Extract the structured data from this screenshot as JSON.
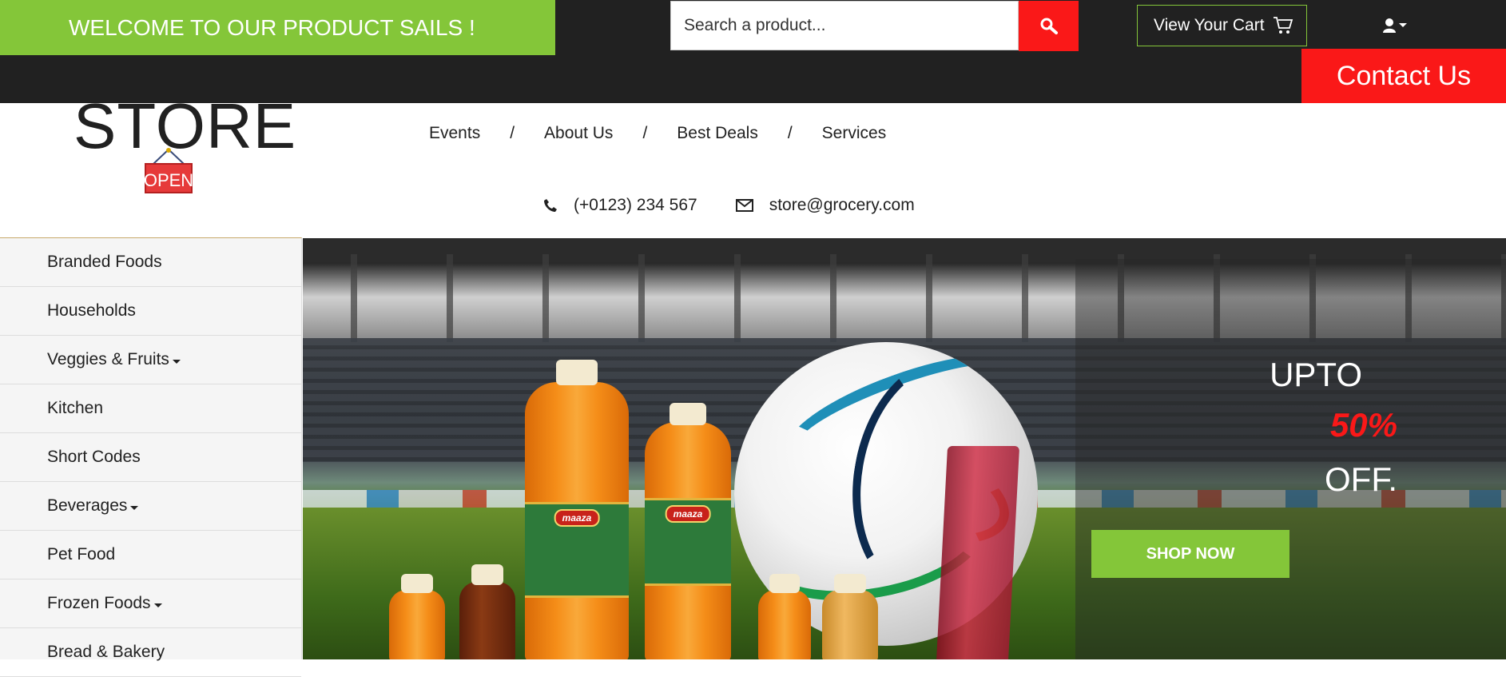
{
  "topbar": {
    "welcome": "WELCOME TO OUR PRODUCT SAILS !",
    "search_placeholder": "Search a product...",
    "cart_label": "View Your Cart",
    "contact_label": "Contact Us"
  },
  "header": {
    "logo_text": "STORE",
    "nav": [
      {
        "label": "Events"
      },
      {
        "label": "About Us"
      },
      {
        "label": "Best Deals"
      },
      {
        "label": "Services"
      }
    ],
    "nav_separator": "/",
    "phone": "(+0123) 234 567",
    "email": "store@grocery.com"
  },
  "sidebar": {
    "items": [
      {
        "label": "Branded Foods"
      },
      {
        "label": "Households"
      },
      {
        "label": "Veggies & Fruits"
      },
      {
        "label": "Kitchen"
      },
      {
        "label": "Short Codes"
      },
      {
        "label": "Beverages"
      },
      {
        "label": "Pet Food"
      },
      {
        "label": "Frozen Foods"
      },
      {
        "label": "Bread & Bakery"
      }
    ]
  },
  "hero": {
    "promo_line1": "UPTO",
    "promo_line2": "50%",
    "promo_line3": "OFF.",
    "cta": "SHOP NOW",
    "bottle_brand": "maaza"
  },
  "colors": {
    "accent_green": "#84c639",
    "accent_red": "#fa1818",
    "dark": "#212121"
  },
  "icons": [
    "search-icon",
    "cart-icon",
    "user-icon",
    "phone-icon",
    "envelope-icon",
    "chevron-down-icon"
  ]
}
